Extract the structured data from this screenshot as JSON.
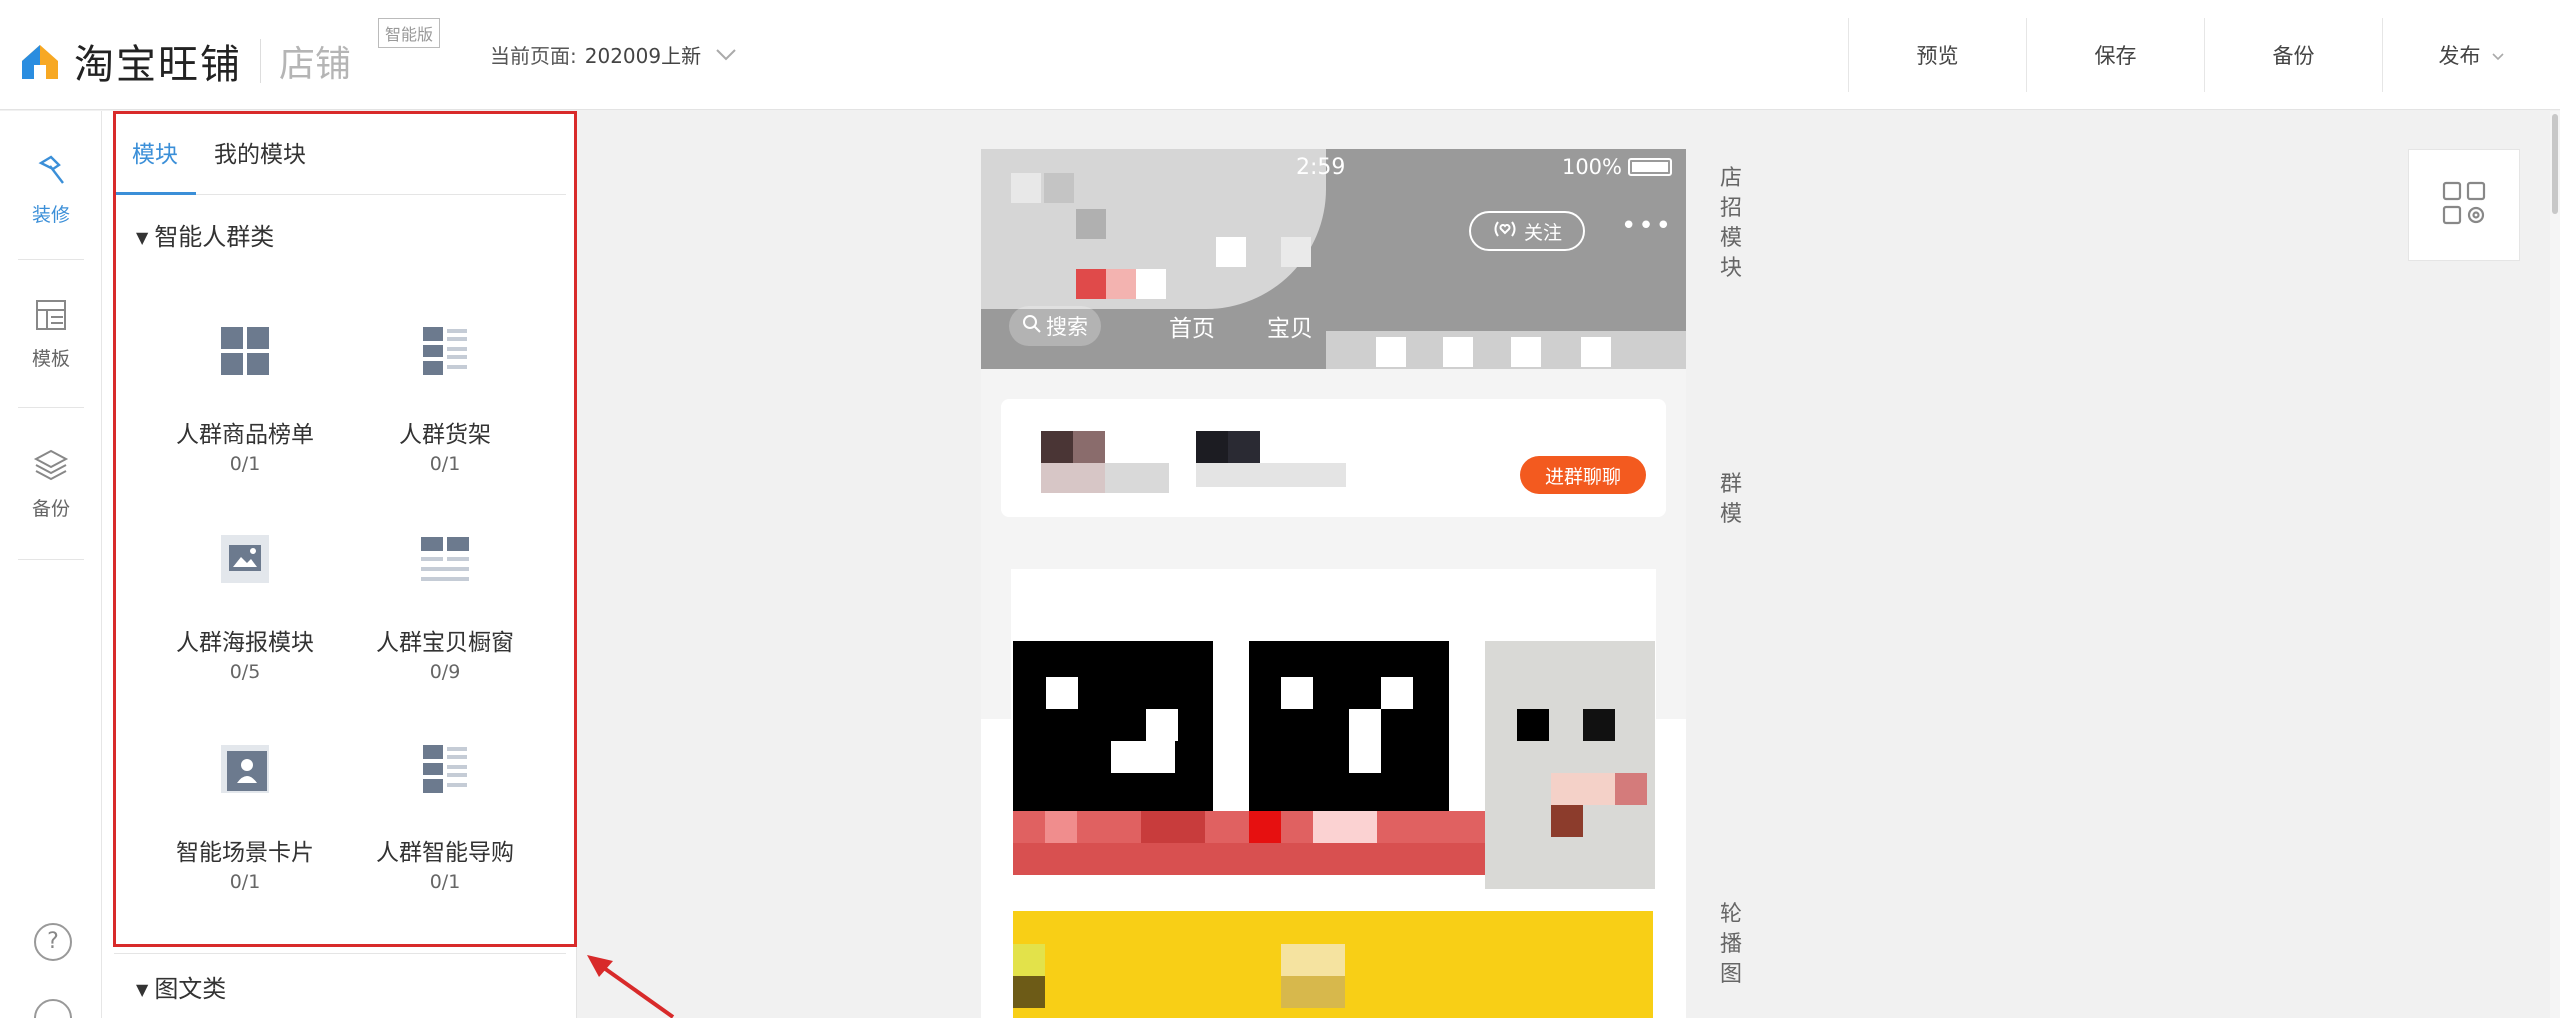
{
  "header": {
    "logo_text": "淘宝旺铺",
    "shop_label": "店铺",
    "edition_badge": "智能版",
    "current_page_label": "当前页面:",
    "current_page_value": "202009上新",
    "actions": [
      "预览",
      "保存",
      "备份",
      "发布"
    ]
  },
  "rail": {
    "items": [
      {
        "label": "装修",
        "icon": "hammer-icon",
        "active": true
      },
      {
        "label": "模板",
        "icon": "template-icon",
        "active": false
      },
      {
        "label": "备份",
        "icon": "layers-icon",
        "active": false
      }
    ],
    "help": "?"
  },
  "panel": {
    "tabs": [
      "模块",
      "我的模块"
    ],
    "active_tab": "模块",
    "group1_title": "智能人群类",
    "modules": [
      {
        "name": "人群商品榜单",
        "count": "0/1",
        "icon": "grid-icon"
      },
      {
        "name": "人群货架",
        "count": "0/1",
        "icon": "list-icon"
      },
      {
        "name": "人群海报模块",
        "count": "0/5",
        "icon": "image-icon"
      },
      {
        "name": "人群宝贝橱窗",
        "count": "0/9",
        "icon": "window-icon"
      },
      {
        "name": "智能场景卡片",
        "count": "0/1",
        "icon": "portrait-card-icon"
      },
      {
        "name": "人群智能导购",
        "count": "0/1",
        "icon": "list-icon"
      }
    ],
    "group2_title": "图文类"
  },
  "phone": {
    "status_time": "2:59",
    "battery": "100%",
    "follow_label": "关注",
    "more_label": "•••",
    "search_label": "搜索",
    "nav": [
      "首页",
      "宝贝"
    ],
    "chat_button": "进群聊聊"
  },
  "side_labels": {
    "shop_sign": "店招模块",
    "group": "群模",
    "carousel": "轮播图"
  },
  "colors": {
    "accent": "#3b8fd8",
    "highlight_red": "#d82a2a",
    "orange_button": "#f35a1f"
  }
}
